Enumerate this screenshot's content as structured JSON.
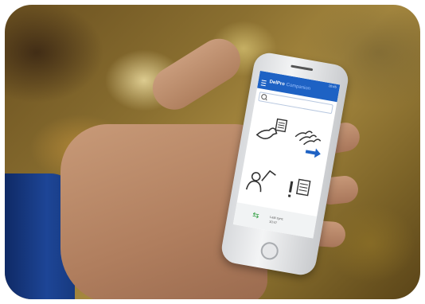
{
  "app": {
    "name": "DelPro",
    "subtitle": "Companion",
    "status_time": "10:45"
  },
  "search": {
    "placeholder": ""
  },
  "tiles": [
    {
      "icon": "cow-list-icon"
    },
    {
      "icon": "herd-move-icon"
    },
    {
      "icon": "cow-person-icon"
    },
    {
      "icon": "alert-list-icon"
    }
  ],
  "footer": {
    "sync_label": "Last sync",
    "sync_time": "10:47"
  },
  "colors": {
    "app_bar": "#1e62c4",
    "sync_icon": "#3aa34a",
    "tile_arrow": "#1e62c4"
  }
}
